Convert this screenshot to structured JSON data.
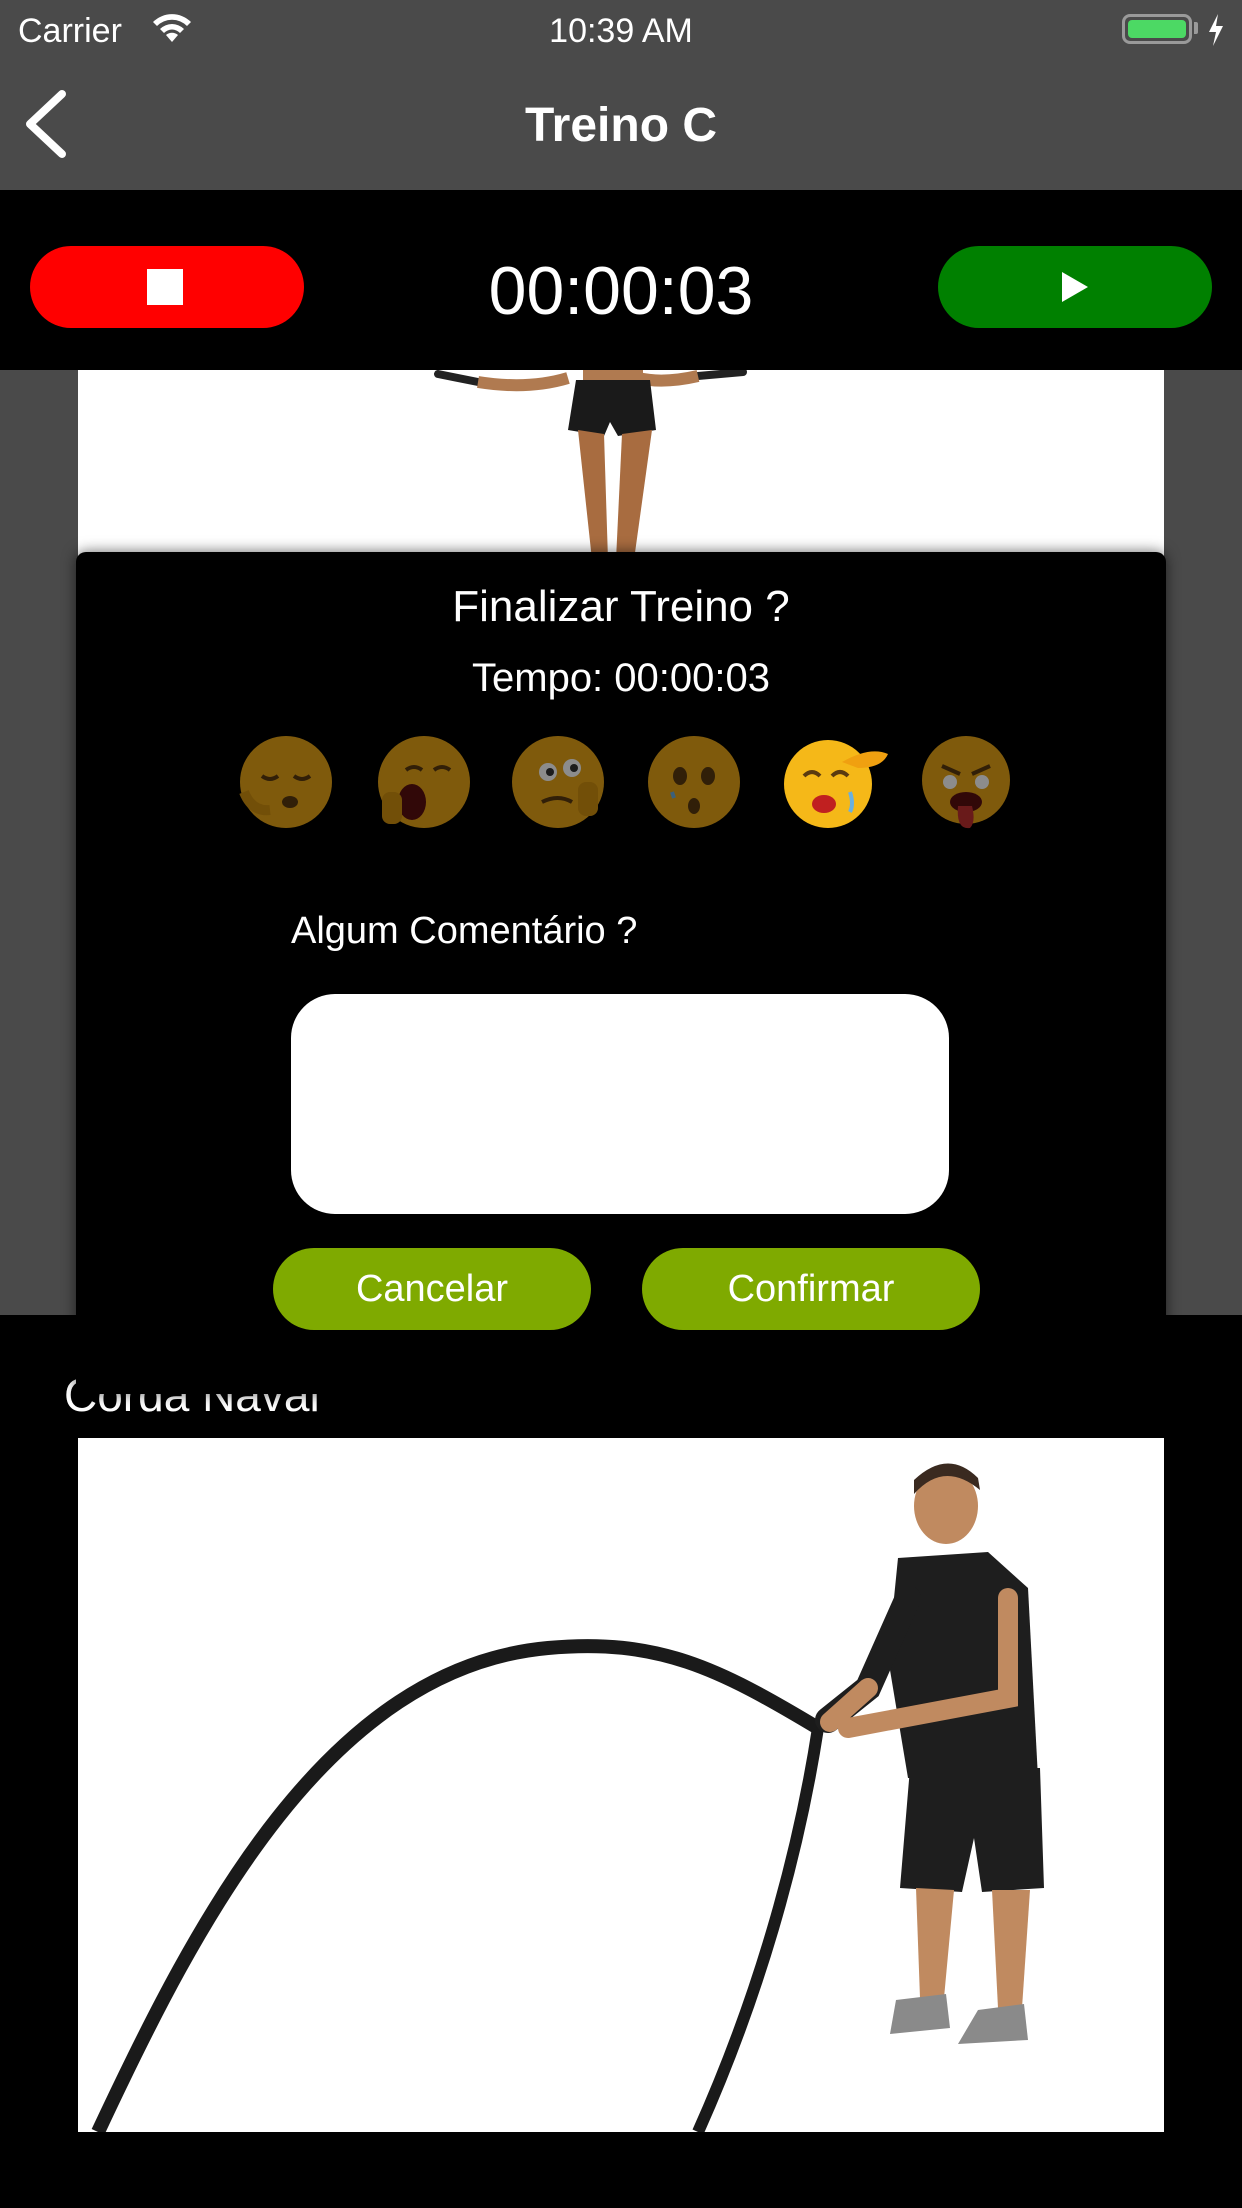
{
  "status_bar": {
    "carrier": "Carrier",
    "time": "10:39 AM",
    "battery_color": "#4cd964"
  },
  "nav": {
    "title": "Treino C",
    "back_icon": "chevron-left-icon"
  },
  "timer": {
    "elapsed": "00:00:03",
    "stop_color": "#ff0000",
    "play_color": "#008000"
  },
  "exercise_list": {
    "second_exercise_title": "Corda Naval"
  },
  "finish_dialog": {
    "title": "Finalizar Treino ?",
    "time_text": "Tempo: 00:00:03",
    "rating_icons": [
      "sleeping-face-icon",
      "yawning-face-icon",
      "sweating-face-icon",
      "worried-face-icon",
      "crying-face-icon",
      "exhausted-face-icon"
    ],
    "selected_rating_index": 4,
    "comment_label": "Algum Comentário ?",
    "comment_value": "",
    "cancel_label": "Cancelar",
    "confirm_label": "Confirmar",
    "button_color": "#7faa00"
  }
}
